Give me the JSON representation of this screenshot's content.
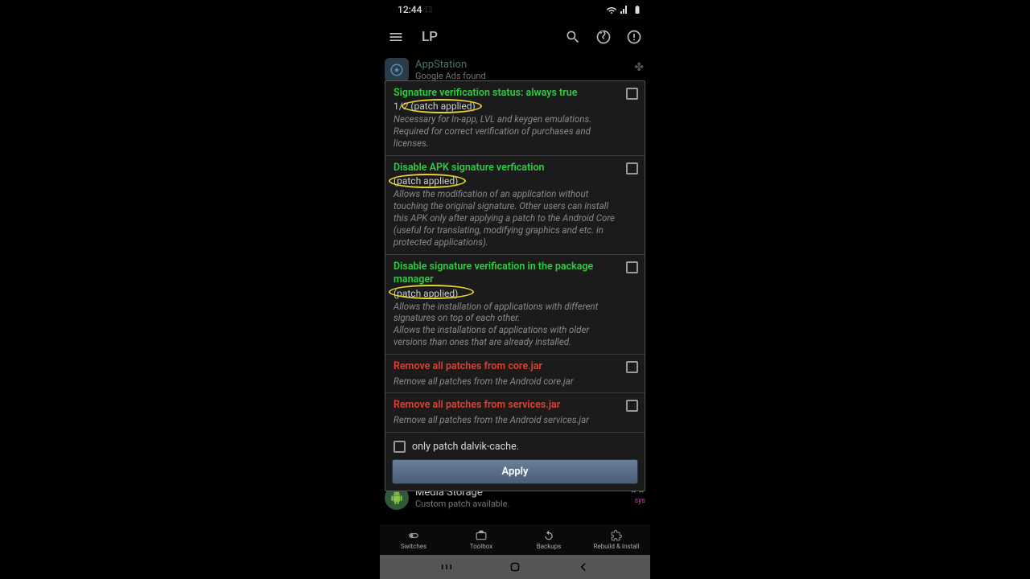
{
  "statusbar": {
    "time": "12:44"
  },
  "appbar": {
    "title": "LP"
  },
  "bg": {
    "item1_title": "AppStation",
    "item1_sub": "Google Ads found",
    "item2_title": "Media Storage",
    "item2_sub": "Custom patch available.",
    "sys": "sys"
  },
  "patches": [
    {
      "title": "Signature verification status: always true",
      "status": "1/2 (patch applied)",
      "desc": "Necessary for In-app, LVL and keygen emulations. Required for correct verification of purchases and licenses.",
      "color": "green"
    },
    {
      "title": "Disable APK signature verfication",
      "status": "(patch applied)",
      "desc": "Allows the modification of an application without touching the original signature. Other users can install this APK only after applying a patch to the Android Core (useful for translating, modifying graphics and etc. in protected applications).",
      "color": "green"
    },
    {
      "title": "Disable signature verification in the package manager",
      "status": "(patch applied)",
      "desc": "Allows the installation of applications with different signatures on top of each other.\nAllows the installations of applications with older versions than ones that are already installed.",
      "color": "green"
    },
    {
      "title": "Remove all patches from core.jar",
      "status": "",
      "desc": "Remove all patches from the Android core.jar",
      "color": "red"
    },
    {
      "title": "Remove all patches from services.jar",
      "status": "",
      "desc": "Remove all patches from the Android services.jar",
      "color": "red"
    }
  ],
  "modal": {
    "footer_label": "only patch dalvik-cache.",
    "apply": "Apply"
  },
  "bottomnav": [
    {
      "label": "Switches"
    },
    {
      "label": "Toolbox"
    },
    {
      "label": "Backups"
    },
    {
      "label": "Rebuild & Install"
    }
  ]
}
